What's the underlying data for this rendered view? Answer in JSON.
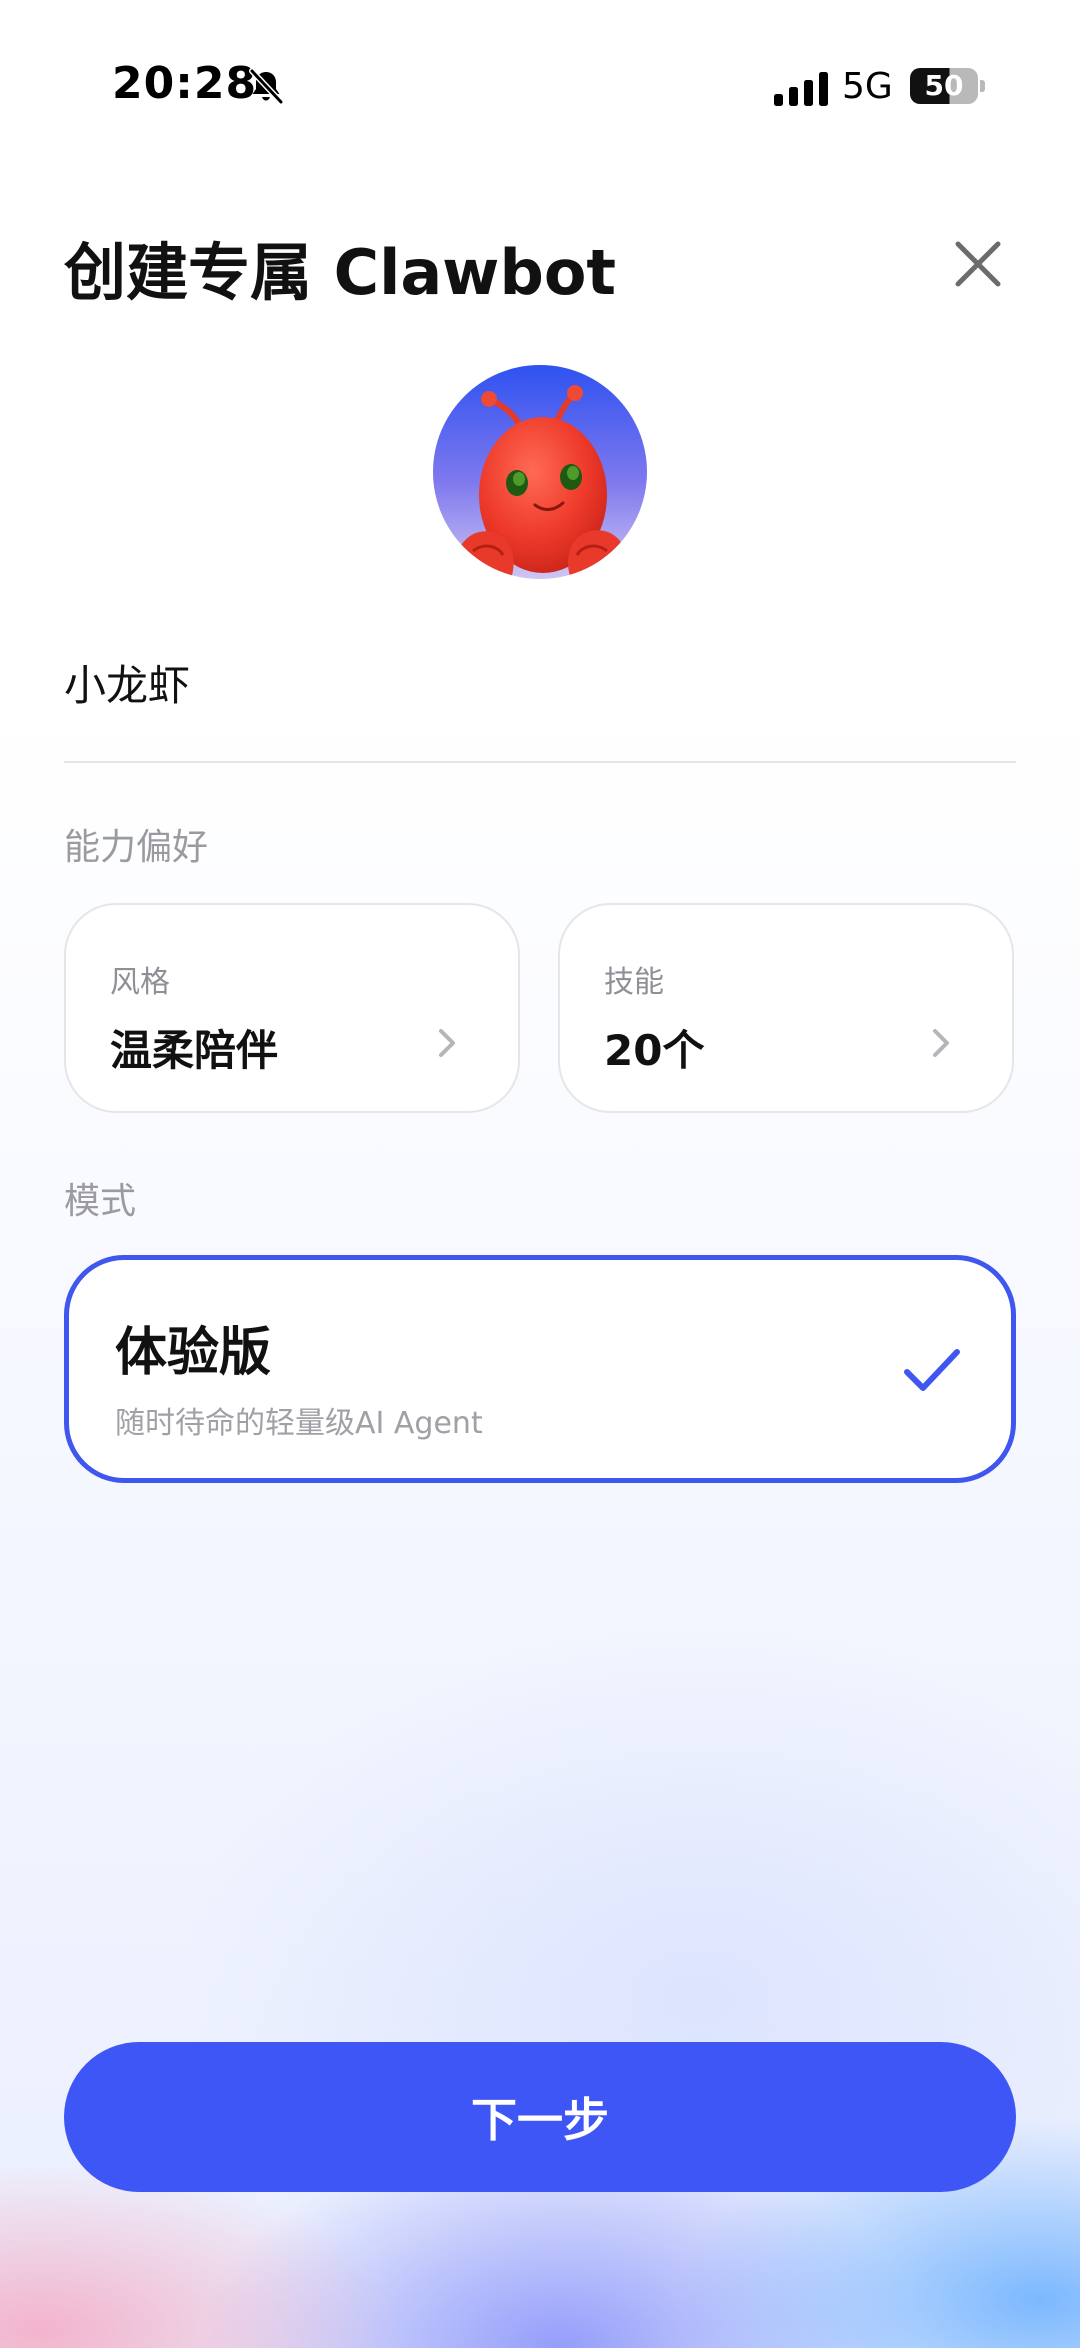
{
  "status_bar": {
    "time": "20:28",
    "network": "5G",
    "battery": "50"
  },
  "header": {
    "title": "创建专属 Clawbot"
  },
  "form": {
    "name_value": "小龙虾",
    "preferences_label": "能力偏好",
    "style_card": {
      "label": "风格",
      "value": "温柔陪伴"
    },
    "skills_card": {
      "label": "技能",
      "value": "20个"
    },
    "mode_label": "模式",
    "mode_card": {
      "title": "体验版",
      "description": "随时待命的轻量级AI Agent",
      "selected": true
    }
  },
  "footer": {
    "next_button": "下一步"
  },
  "colors": {
    "accent": "#3f56f6",
    "selected_border": "#3f56ef"
  },
  "icons": [
    "bell-slash-icon",
    "signal-icon",
    "battery-icon",
    "close-icon",
    "chevron-right-icon",
    "checkmark-icon"
  ]
}
